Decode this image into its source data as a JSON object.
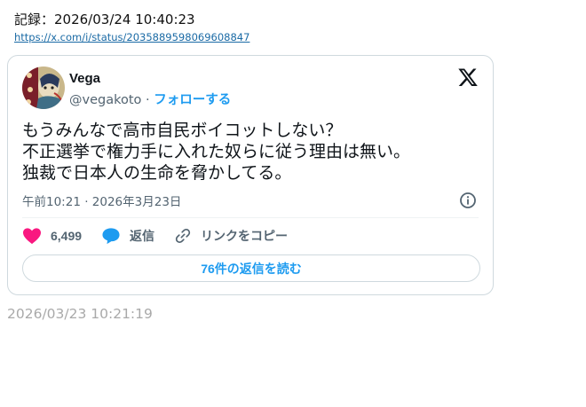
{
  "record": {
    "label": "記録：2026/03/24 10:40:23",
    "url": "https://x.com/i/status/2035889598069608847"
  },
  "tweet": {
    "display_name": "Vega",
    "handle": "@vegakoto",
    "separator": "·",
    "follow_label": "フォローする",
    "text": "もうみんなで高市自民ボイコットしない？\n不正選挙で権力手に入れた奴らに従う理由は無い。\n独裁で日本人の生命を脅かしてる。",
    "timestamp": "午前10:21 · 2026年3月23日",
    "likes": "6,499",
    "reply_label": "返信",
    "copy_link_label": "リンクをコピー",
    "read_replies_label": "76件の返信を読む"
  },
  "footer": {
    "captured_time": "2026/03/23 10:21:19"
  },
  "colors": {
    "accent": "#1d9bf0",
    "like": "#f91880",
    "muted": "#536471",
    "border": "#cfd9de"
  },
  "icons": [
    "x-logo-icon",
    "info-icon",
    "heart-icon",
    "reply-bubble-icon",
    "link-icon"
  ]
}
